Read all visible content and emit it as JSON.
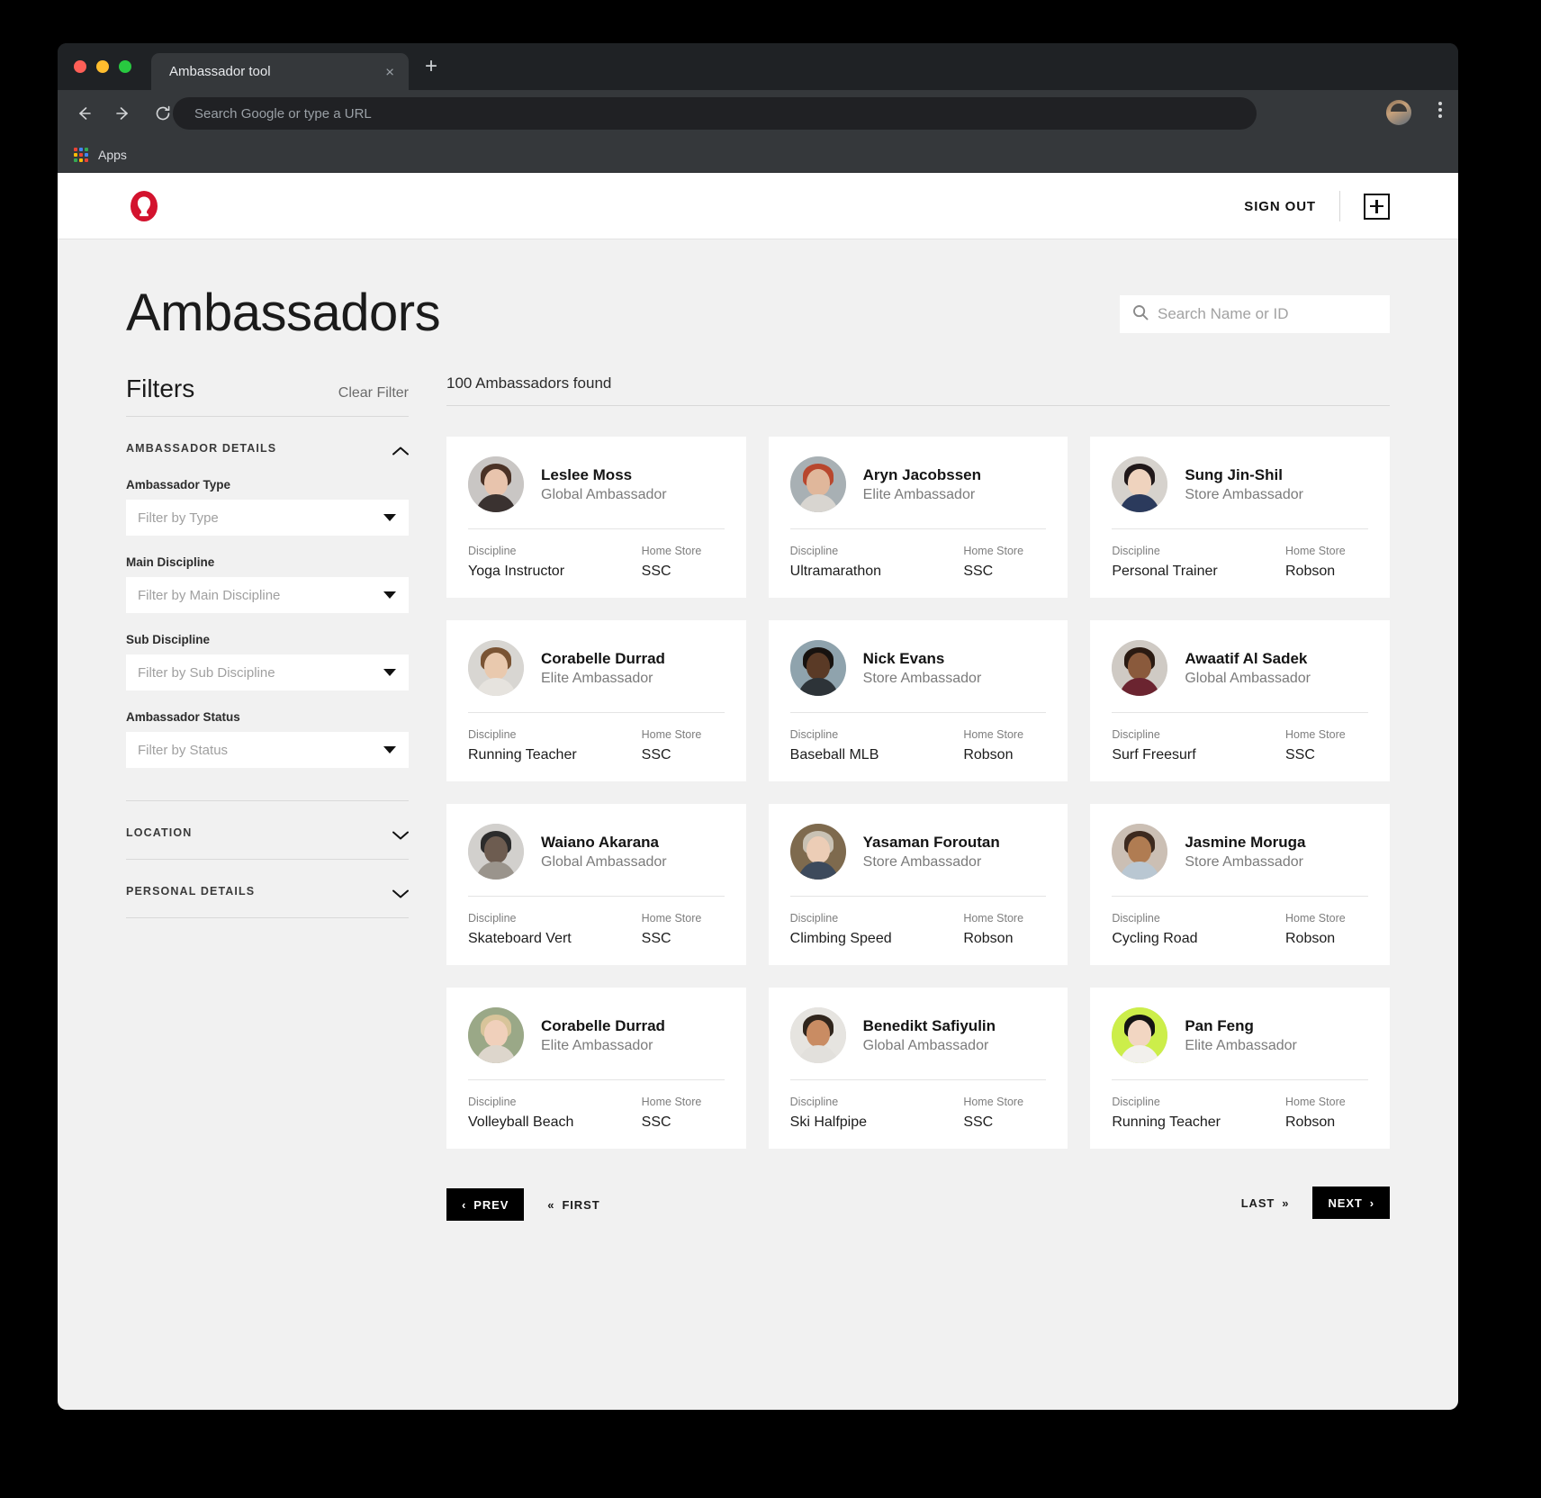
{
  "browser": {
    "tab_title": "Ambassador tool",
    "omnibox_placeholder": "Search Google or type a URL",
    "bookmarks_label": "Apps",
    "new_tab_label": "+",
    "close_tab_label": "×"
  },
  "header": {
    "logo_name": "lululemon-logo",
    "sign_out_label": "SIGN OUT",
    "add_button_name": "add-ambassador-button"
  },
  "page": {
    "title": "Ambassadors",
    "search_placeholder": "Search Name or ID",
    "search_value": ""
  },
  "filters": {
    "title": "Filters",
    "clear_label": "Clear Filter",
    "sections": [
      {
        "title": "AMBASSADOR DETAILS",
        "expanded": true,
        "fields": [
          {
            "label": "Ambassador Type",
            "placeholder": "Filter by Type",
            "value": ""
          },
          {
            "label": "Main Discipline",
            "placeholder": "Filter by Main Discipline",
            "value": ""
          },
          {
            "label": "Sub Discipline",
            "placeholder": "Filter by Sub Discipline",
            "value": ""
          },
          {
            "label": "Ambassador Status",
            "placeholder": "Filter by Status",
            "value": ""
          }
        ]
      },
      {
        "title": "LOCATION",
        "expanded": false,
        "fields": []
      },
      {
        "title": "PERSONAL DETAILS",
        "expanded": false,
        "fields": []
      }
    ]
  },
  "results": {
    "count_label": "100 Ambassadors found",
    "meta_labels": {
      "discipline": "Discipline",
      "home_store": "Home Store"
    },
    "cards": [
      {
        "name": "Leslee Moss",
        "type": "Global Ambassador",
        "discipline": "Yoga Instructor",
        "home_store": "SSC",
        "avatar": {
          "bg": "#c9c6c4",
          "hair": "#4a3226",
          "skin": "#e8c4ad",
          "body": "#3a3230"
        }
      },
      {
        "name": "Aryn Jacobssen",
        "type": "Elite Ambassador",
        "discipline": "Ultramarathon",
        "home_store": "SSC",
        "avatar": {
          "bg": "#a8b0b4",
          "hair": "#b8472e",
          "skin": "#e0b79b",
          "body": "#d8d5d0"
        }
      },
      {
        "name": "Sung Jin-Shil",
        "type": "Store Ambassador",
        "discipline": "Personal Trainer",
        "home_store": "Robson",
        "avatar": {
          "bg": "#d6d2cd",
          "hair": "#20181a",
          "skin": "#efd3be",
          "body": "#2b3a5c"
        }
      },
      {
        "name": "Corabelle Durrad",
        "type": "Elite Ambassador",
        "discipline": "Running Teacher",
        "home_store": "SSC",
        "avatar": {
          "bg": "#d8d6d2",
          "hair": "#7a5434",
          "skin": "#e9c9ae",
          "body": "#e6e3de"
        }
      },
      {
        "name": "Nick Evans",
        "type": "Store Ambassador",
        "discipline": "Baseball MLB",
        "home_store": "Robson",
        "avatar": {
          "bg": "#8fa3ad",
          "hair": "#17120f",
          "skin": "#5a3a26",
          "body": "#2d3338"
        }
      },
      {
        "name": "Awaatif Al Sadek",
        "type": "Global Ambassador",
        "discipline": "Surf Freesurf",
        "home_store": "SSC",
        "avatar": {
          "bg": "#cfcac4",
          "hair": "#2a1a12",
          "skin": "#8a5a3c",
          "body": "#6b2430"
        }
      },
      {
        "name": "Waiano Akarana",
        "type": "Global Ambassador",
        "discipline": "Skateboard Vert",
        "home_store": "SSC",
        "avatar": {
          "bg": "#d2d0cd",
          "hair": "#2c2c2c",
          "skin": "#6d5c50",
          "body": "#9a948c"
        }
      },
      {
        "name": "Yasaman Foroutan",
        "type": "Store Ambassador",
        "discipline": "Climbing Speed",
        "home_store": "Robson",
        "avatar": {
          "bg": "#7e6a4e",
          "hair": "#c9c2b4",
          "skin": "#eccdb6",
          "body": "#3d4a5c"
        }
      },
      {
        "name": "Jasmine Moruga",
        "type": "Store Ambassador",
        "discipline": "Cycling Road",
        "home_store": "Robson",
        "avatar": {
          "bg": "#cbbfb4",
          "hair": "#3d2a1f",
          "skin": "#b07c52",
          "body": "#b9c7d2"
        }
      },
      {
        "name": "Corabelle Durrad",
        "type": "Elite Ambassador",
        "discipline": "Volleyball Beach",
        "home_store": "SSC",
        "avatar": {
          "bg": "#9aa887",
          "hair": "#d8c49a",
          "skin": "#f0d0bb",
          "body": "#ddd6cc"
        }
      },
      {
        "name": "Benedikt Safiyulin",
        "type": "Global Ambassador",
        "discipline": "Ski Halfpipe",
        "home_store": "SSC",
        "avatar": {
          "bg": "#e6e4e0",
          "hair": "#30251c",
          "skin": "#c98c63",
          "body": "#e2e0dc"
        }
      },
      {
        "name": "Pan Feng",
        "type": "Elite Ambassador",
        "discipline": "Running Teacher",
        "home_store": "Robson",
        "avatar": {
          "bg": "#ccee4a",
          "hair": "#141414",
          "skin": "#f2d6c2",
          "body": "#f2f0ec"
        }
      }
    ]
  },
  "pagination": {
    "prev_label": "PREV",
    "first_label": "FIRST",
    "last_label": "LAST",
    "next_label": "NEXT",
    "prev_chevron": "‹",
    "first_chevron": "«",
    "last_chevron": "»",
    "next_chevron": "›"
  },
  "colors": {
    "brand_red": "#d3132e",
    "accent_black": "#000000",
    "page_bg": "#f1f1f1"
  }
}
